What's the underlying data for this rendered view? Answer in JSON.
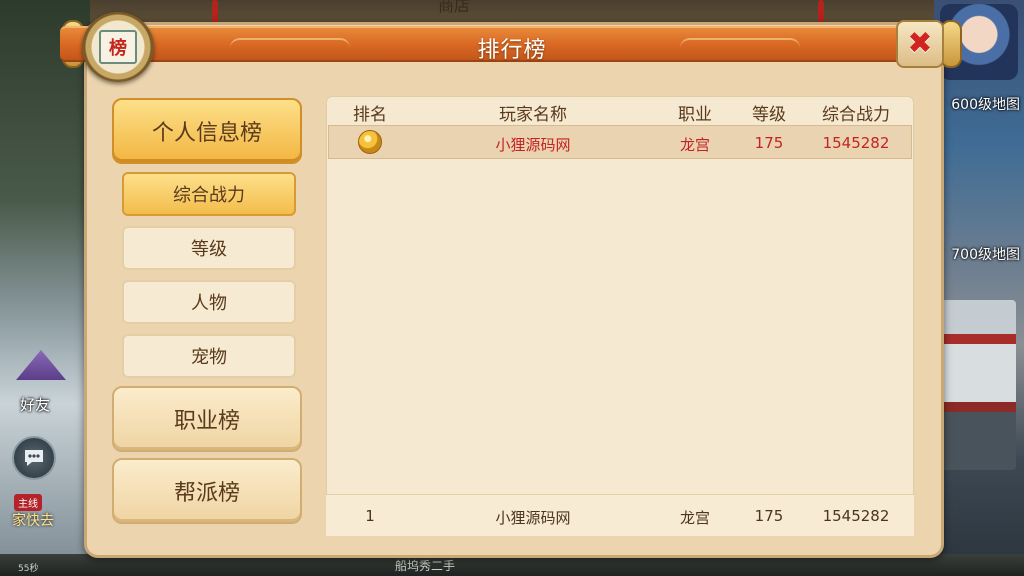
{
  "background": {
    "top_label": "商店",
    "right_labels": [
      "600级地图",
      "700级地图"
    ],
    "friend_label": "好友",
    "chat_icon": "chat-bubble-icon",
    "quest_tag": "主线",
    "quest_text": "家快去",
    "bottom_text": "船坞秀二手",
    "bottom_left_text": "55秒"
  },
  "panel": {
    "title": "排行榜",
    "badge_char": "榜",
    "close_icon": "close-icon"
  },
  "sidebar": {
    "main_tabs": [
      {
        "label": "个人信息榜",
        "active": true
      },
      {
        "label": "职业榜",
        "active": false
      },
      {
        "label": "帮派榜",
        "active": false
      }
    ],
    "sub_tabs": [
      {
        "label": "综合战力",
        "active": true
      },
      {
        "label": "等级",
        "active": false
      },
      {
        "label": "人物",
        "active": false
      },
      {
        "label": "宠物",
        "active": false
      }
    ]
  },
  "table": {
    "headers": [
      "排名",
      "玩家名称",
      "职业",
      "等级",
      "综合战力"
    ],
    "rows": [
      {
        "rank_icon": "gold-medal-icon",
        "name": "小狸源码网",
        "class": "龙宫",
        "level": "175",
        "power": "1545282"
      }
    ],
    "my_rank": {
      "rank": "1",
      "name": "小狸源码网",
      "class": "龙宫",
      "level": "175",
      "power": "1545282"
    }
  },
  "colors": {
    "title_bar": "#d86722",
    "panel_bg": "#ecd5ae",
    "active_tab": "#f2b540",
    "highlight_text": "#c42323"
  }
}
